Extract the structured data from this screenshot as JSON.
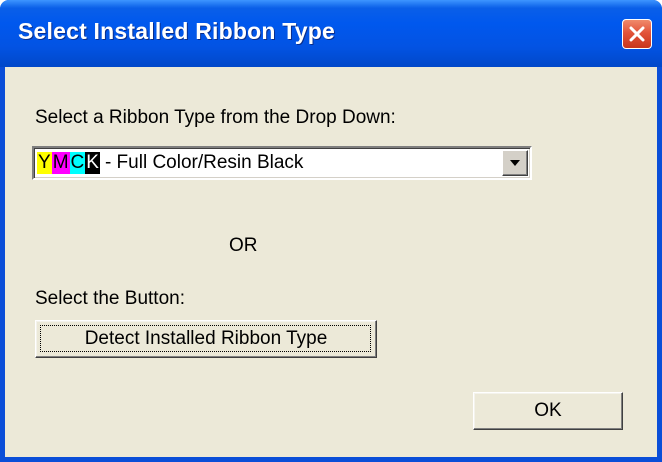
{
  "window": {
    "title": "Select Installed Ribbon Type",
    "close_icon": "close-icon"
  },
  "prompt_dropdown": "Select a Ribbon Type from the Drop Down:",
  "ribbon_select": {
    "selected_code_letters": [
      "Y",
      "M",
      "C",
      "K"
    ],
    "selected_code_colors": [
      "#FFFF00",
      "#FF00FF",
      "#00FFFF",
      "#000000"
    ],
    "selected_label": " - Full Color/Resin Black",
    "arrow_icon": "chevron-down-icon"
  },
  "or_text": "OR",
  "prompt_button": "Select the Button:",
  "detect_button_label": "Detect Installed Ribbon Type",
  "ok_button_label": "OK",
  "colors": {
    "titlebar": "#0058EE",
    "close_button": "#E2543A",
    "dialog_face": "#ECE9D8"
  }
}
